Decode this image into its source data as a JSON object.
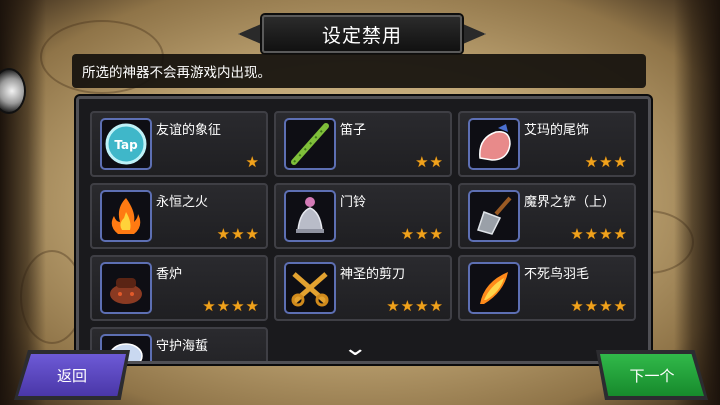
{
  "title": "设定禁用",
  "description": "所选的神器不会再游戏内出现。",
  "items": [
    {
      "name": "友谊的象征",
      "stars": "★",
      "icon": "tap-coin-icon"
    },
    {
      "name": "笛子",
      "stars": "★★",
      "icon": "bamboo-flute-icon"
    },
    {
      "name": "艾玛的尾饰",
      "stars": "★★★",
      "icon": "pink-tail-icon"
    },
    {
      "name": "永恒之火",
      "stars": "★★★",
      "icon": "fire-icon"
    },
    {
      "name": "门铃",
      "stars": "★★★",
      "icon": "bell-icon"
    },
    {
      "name": "魔界之铲（上）",
      "stars": "★★★★",
      "icon": "shovel-icon"
    },
    {
      "name": "香炉",
      "stars": "★★★★",
      "icon": "incense-burner-icon"
    },
    {
      "name": "神圣的剪刀",
      "stars": "★★★★",
      "icon": "scissors-icon"
    },
    {
      "name": "不死鸟羽毛",
      "stars": "★★★★",
      "icon": "phoenix-feather-icon"
    },
    {
      "name": "守护海蜇",
      "stars": "",
      "icon": "jellyfish-icon"
    }
  ],
  "buttons": {
    "back": "返回",
    "next": "下一个"
  },
  "colors": {
    "star": "#f0a21c",
    "back": "#5a46c0",
    "next": "#22a23a"
  }
}
